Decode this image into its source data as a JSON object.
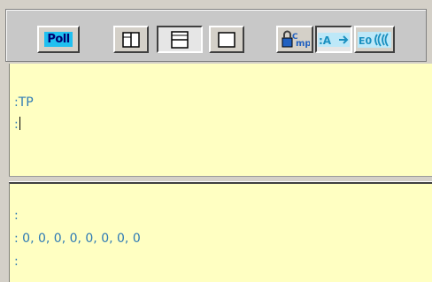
{
  "toolbar": {
    "poll_label": "Poll",
    "buttons": [
      {
        "icon": "split-vertical-icon"
      },
      {
        "icon": "split-horizontal-icon"
      },
      {
        "icon": "single-pane-icon"
      },
      {
        "icon": "abbrev-cmd-icon"
      },
      {
        "icon": "auto-send-icon"
      },
      {
        "icon": "echo-icon"
      }
    ]
  },
  "command_pane": {
    "lines": [
      ":TP",
      ":"
    ]
  },
  "response_pane": {
    "lines": [
      ":",
      ": 0, 0, 0, 0, 0, 0, 0, 0",
      ":"
    ]
  },
  "colors": {
    "pane_background": "#ffffc2",
    "text": "#2e7ab5",
    "poll_badge": "#20c0f0"
  }
}
